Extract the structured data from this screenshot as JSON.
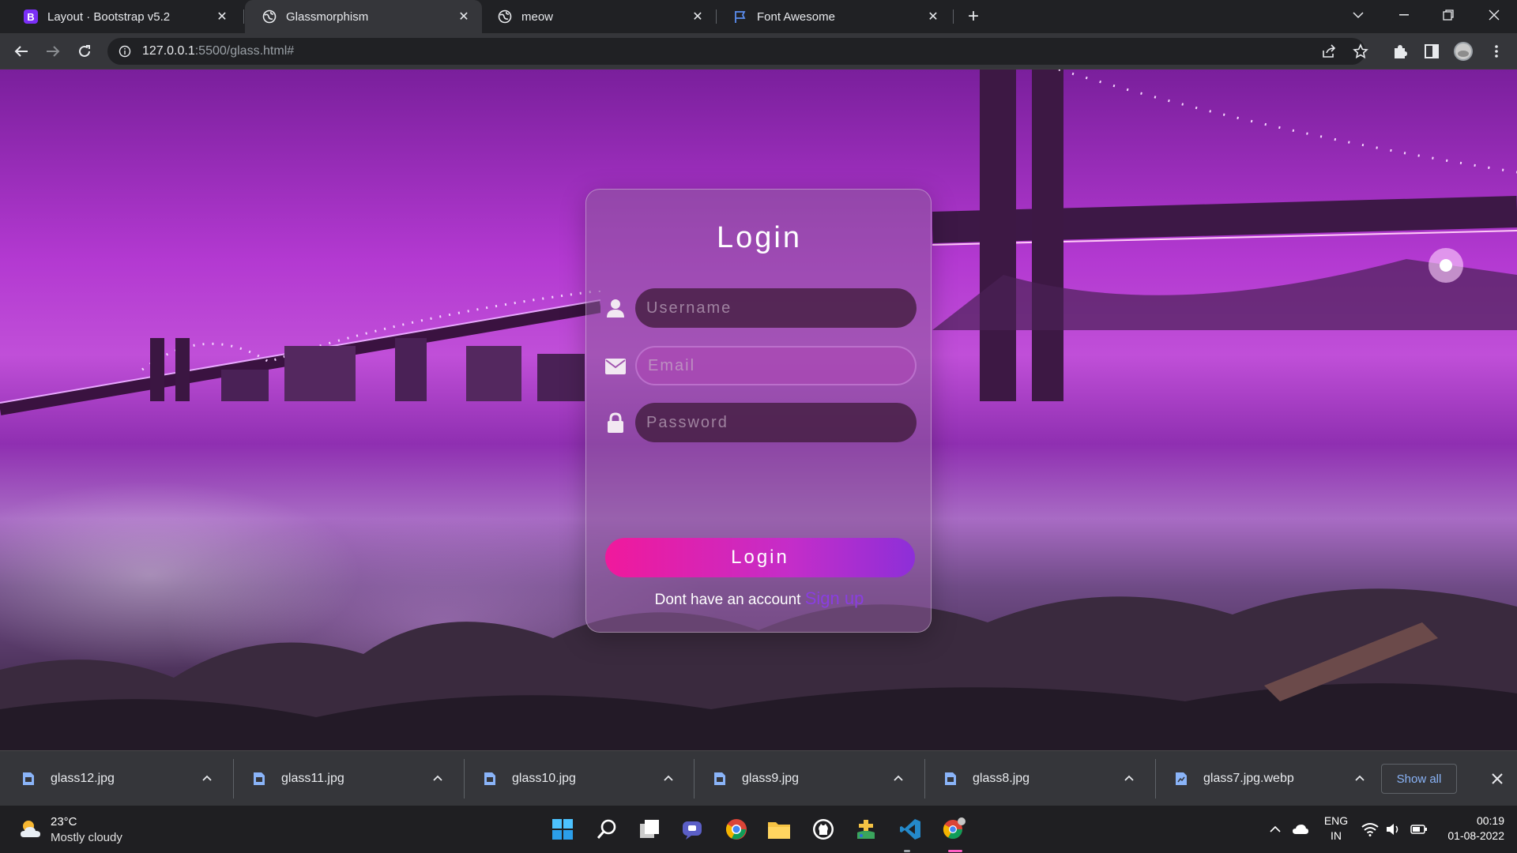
{
  "browser": {
    "tabs": [
      {
        "title": "Layout · Bootstrap v5.2",
        "icon": "bootstrap-icon",
        "active": false
      },
      {
        "title": "Glassmorphism",
        "icon": "globe-icon",
        "active": true
      },
      {
        "title": "meow",
        "icon": "globe-icon",
        "active": false
      },
      {
        "title": "Font Awesome",
        "icon": "flag-icon",
        "active": false
      }
    ],
    "url_host": "127.0.0.1",
    "url_path": ":5500/glass.html#"
  },
  "login": {
    "title": "Login",
    "username_placeholder": "Username",
    "email_placeholder": "Email",
    "password_placeholder": "Password",
    "button_label": "Login",
    "no_account_text": "Dont have an account",
    "signup_link": "Sign up"
  },
  "downloads": {
    "items": [
      "glass12.jpg",
      "glass11.jpg",
      "glass10.jpg",
      "glass9.jpg",
      "glass8.jpg",
      "glass7.jpg.webp"
    ],
    "show_all": "Show all"
  },
  "taskbar": {
    "weather_temp": "23°C",
    "weather_desc": "Mostly cloudy",
    "lang_line1": "ENG",
    "lang_line2": "IN",
    "time": "00:19",
    "date": "01-08-2022"
  },
  "colors": {
    "accent_pink": "#f0199c",
    "accent_purple": "#8d2fd8",
    "signup_link": "#8a3ee0",
    "download_link": "#8ab4f8"
  }
}
